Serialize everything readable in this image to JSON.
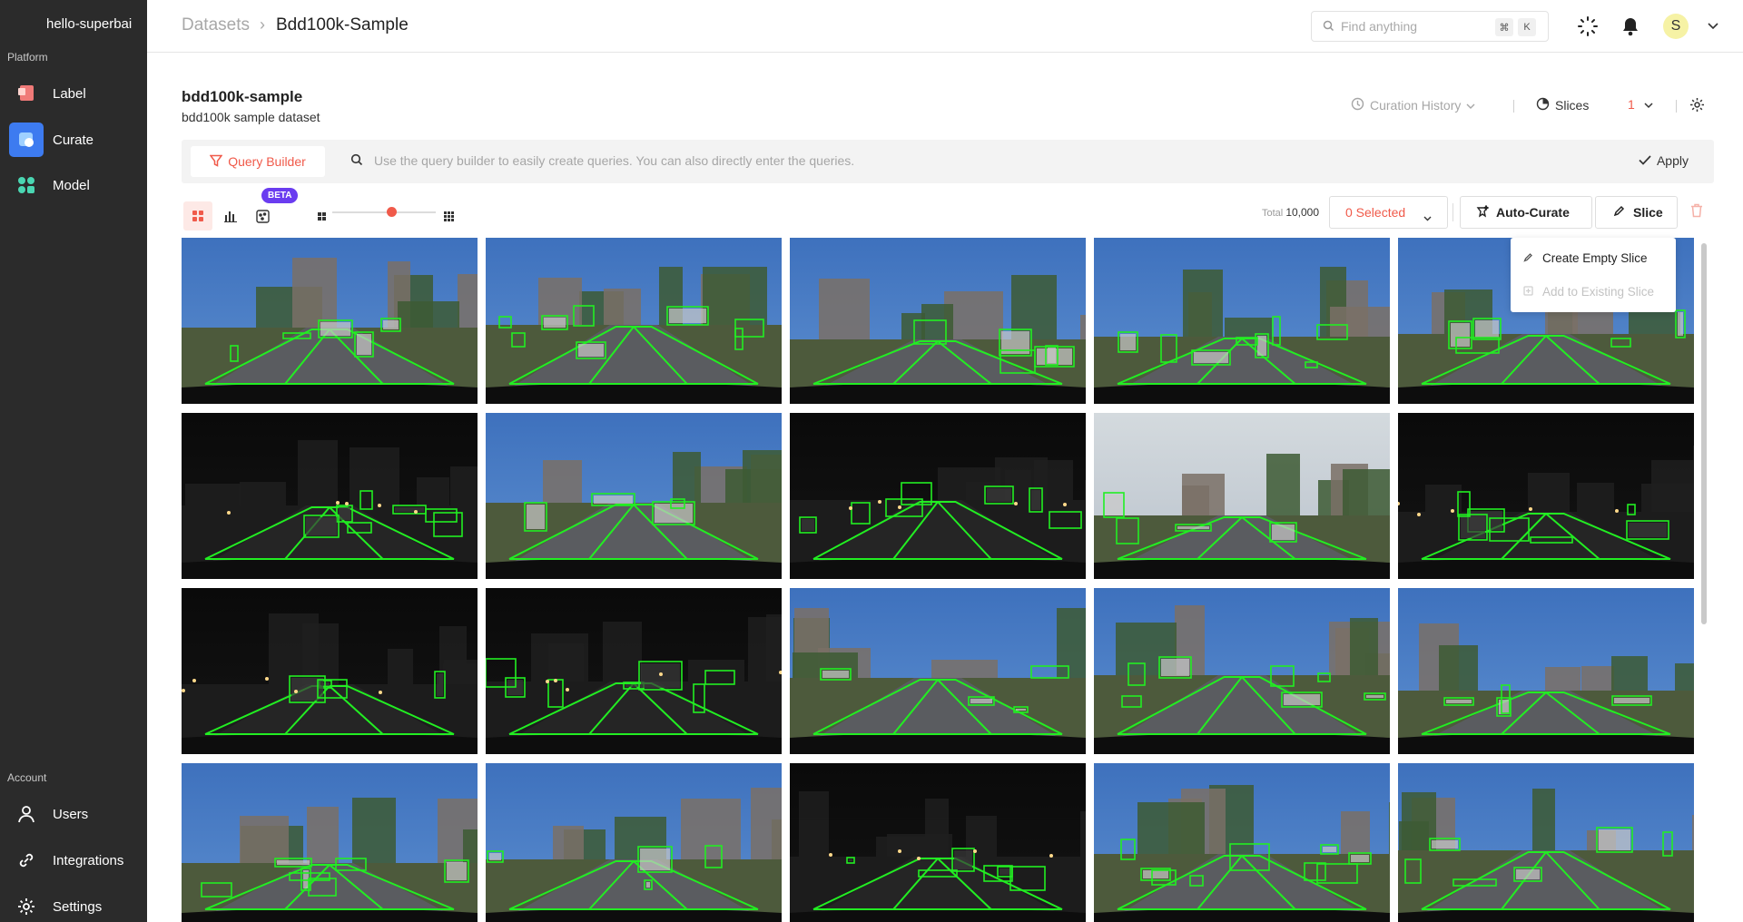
{
  "sidebar": {
    "org": "hello-superbai",
    "platform_label": "Platform",
    "account_label": "Account",
    "platform_items": [
      {
        "label": "Label",
        "icon": "label-icon",
        "active": false
      },
      {
        "label": "Curate",
        "icon": "curate-icon",
        "active": true
      },
      {
        "label": "Model",
        "icon": "model-icon",
        "active": false
      }
    ],
    "account_items": [
      {
        "label": "Users",
        "icon": "user-icon"
      },
      {
        "label": "Integrations",
        "icon": "link-icon"
      },
      {
        "label": "Settings",
        "icon": "gear-icon"
      }
    ]
  },
  "topbar": {
    "breadcrumb_parent": "Datasets",
    "breadcrumb_separator": "›",
    "breadcrumb_current": "Bdd100k-Sample",
    "search_placeholder": "Find anything",
    "shortcut_keys": [
      "⌘",
      "K"
    ],
    "avatar_initial": "S"
  },
  "dataset": {
    "name": "bdd100k-sample",
    "description": "bdd100k sample dataset",
    "curation_history_label": "Curation History",
    "slices_label": "Slices",
    "slices_count": "1"
  },
  "query": {
    "builder_label": "Query Builder",
    "placeholder": "Use the query builder to easily create queries. You can also directly enter the queries.",
    "apply_label": "Apply"
  },
  "toolbar": {
    "beta_label": "BETA",
    "total_label": "Total",
    "total_value": "10,000",
    "selected_label": "0 Selected",
    "auto_curate_label": "Auto-Curate",
    "slice_label": "Slice",
    "zoom_level": 0.55
  },
  "slice_menu": {
    "items": [
      {
        "label": "Create Empty Slice",
        "enabled": true
      },
      {
        "label": "Add to Existing Slice",
        "enabled": false
      }
    ]
  },
  "colors": {
    "accent": "#f05a4a",
    "sidebar_bg": "#2b2b2b",
    "active_nav": "#3d7bf0",
    "bbox": "#22ee22",
    "beta": "#6a3cf0"
  },
  "gallery": {
    "columns": 5,
    "images": [
      {
        "scene": "day-overpass"
      },
      {
        "scene": "day-fedex-truck"
      },
      {
        "scene": "day-highway-open"
      },
      {
        "scene": "day-city-taxi"
      },
      {
        "scene": "day-street-trees"
      },
      {
        "scene": "night-road"
      },
      {
        "scene": "day-suburban"
      },
      {
        "scene": "night-bridge-lights"
      },
      {
        "scene": "overcast-highway"
      },
      {
        "scene": "dusk-street"
      },
      {
        "scene": "night-city"
      },
      {
        "scene": "night-crosswalk"
      },
      {
        "scene": "day-highway-poles"
      },
      {
        "scene": "day-open-road"
      },
      {
        "scene": "day-bridge-traffic"
      },
      {
        "scene": "day-hill-street"
      },
      {
        "scene": "day-residential"
      },
      {
        "scene": "night-intersection"
      },
      {
        "scene": "day-downtown"
      },
      {
        "scene": "day-trolley"
      }
    ]
  }
}
